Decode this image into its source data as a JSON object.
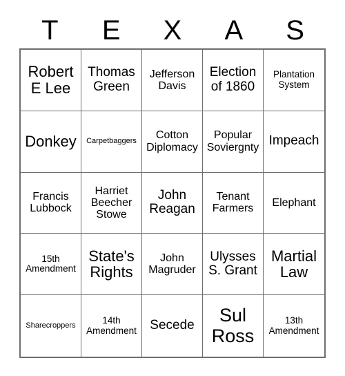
{
  "card": {
    "title_letters": [
      "T",
      "E",
      "X",
      "A",
      "S"
    ],
    "colors": {
      "border": "#6e6e6e",
      "text": "#000000",
      "background": "#ffffff"
    },
    "grid": {
      "rows": 5,
      "columns": 5,
      "cells": [
        {
          "text": "Robert E Lee",
          "size": "xl"
        },
        {
          "text": "Thomas Green",
          "size": "lg"
        },
        {
          "text": "Jefferson Davis",
          "size": "md"
        },
        {
          "text": "Election of 1860",
          "size": "lg"
        },
        {
          "text": "Plantation System",
          "size": "sm"
        },
        {
          "text": "Donkey",
          "size": "xl"
        },
        {
          "text": "Carpetbaggers",
          "size": "xs"
        },
        {
          "text": "Cotton Diplomacy",
          "size": "md"
        },
        {
          "text": "Popular Soviergnty",
          "size": "md"
        },
        {
          "text": "Impeach",
          "size": "lg"
        },
        {
          "text": "Francis Lubbock",
          "size": "md"
        },
        {
          "text": "Harriet Beecher Stowe",
          "size": "md"
        },
        {
          "text": "John Reagan",
          "size": "lg"
        },
        {
          "text": "Tenant Farmers",
          "size": "md"
        },
        {
          "text": "Elephant",
          "size": "md"
        },
        {
          "text": "15th Amendment",
          "size": "sm"
        },
        {
          "text": "State's Rights",
          "size": "xl"
        },
        {
          "text": "John Magruder",
          "size": "md"
        },
        {
          "text": "Ulysses S. Grant",
          "size": "lg"
        },
        {
          "text": "Martial Law",
          "size": "xl"
        },
        {
          "text": "Sharecroppers",
          "size": "xs"
        },
        {
          "text": "14th Amendment",
          "size": "sm"
        },
        {
          "text": "Secede",
          "size": "lg"
        },
        {
          "text": "Sul Ross",
          "size": "xxl"
        },
        {
          "text": "13th Amendment",
          "size": "sm"
        }
      ]
    }
  }
}
